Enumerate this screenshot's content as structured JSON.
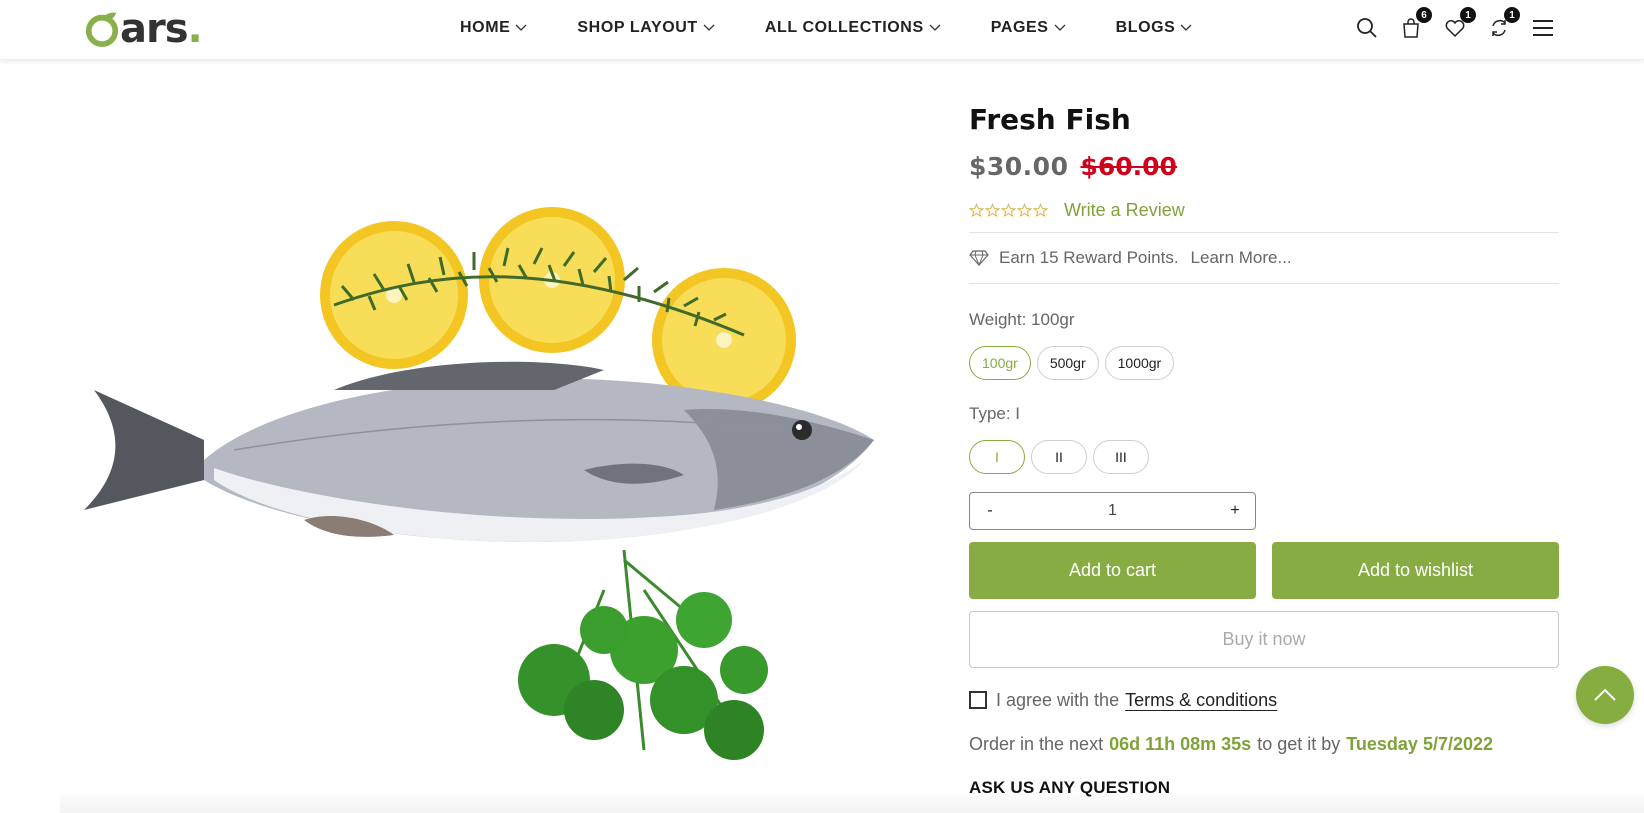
{
  "brand": {
    "logo_text": "ars",
    "logo_dot": "."
  },
  "nav": {
    "items": [
      {
        "label": "HOME"
      },
      {
        "label": "SHOP LAYOUT"
      },
      {
        "label": "ALL COLLECTIONS"
      },
      {
        "label": "PAGES"
      },
      {
        "label": "BLOGS"
      }
    ]
  },
  "header_icons": {
    "search": "search-icon",
    "cart": {
      "icon": "cart-icon",
      "count": "6"
    },
    "wishlist": {
      "icon": "heart-icon",
      "count": "1"
    },
    "compare": {
      "icon": "compare-icon",
      "count": "1"
    },
    "menu": "hamburger-icon"
  },
  "product": {
    "title": "Fresh Fish",
    "price": "$30.00",
    "old_price": "$60.00",
    "rating": 0,
    "rating_max": 5,
    "review_link": "Write a Review",
    "reward_text": "Earn 15 Reward Points.",
    "reward_link": "Learn More...",
    "weight_label": "Weight: 100gr",
    "weights": [
      "100gr",
      "500gr",
      "1000gr"
    ],
    "type_label": "Type: I",
    "types": [
      "I",
      "II",
      "III"
    ],
    "quantity": "1",
    "qty_minus": "-",
    "qty_plus": "+",
    "add_to_cart": "Add to cart",
    "add_to_wishlist": "Add to wishlist",
    "buy_now": "Buy it now",
    "agree_text": "I agree with the",
    "terms_link": "Terms & conditions",
    "order_prefix": "Order in the next",
    "countdown": "06d 11h 08m 35s",
    "order_mid": "to get it by",
    "delivery_date": "Tuesday 5/7/2022",
    "ask_question": "ASK US ANY QUESTION"
  },
  "colors": {
    "accent": "#88ac44",
    "old_price": "#d0021b",
    "text": "#222222"
  }
}
